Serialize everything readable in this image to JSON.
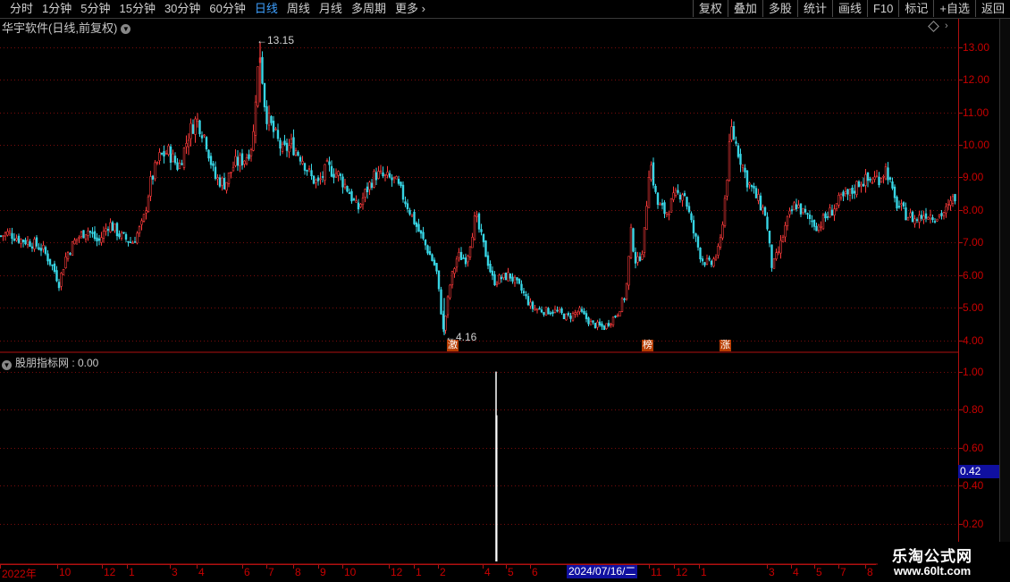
{
  "toolbar": {
    "periods": [
      "分时",
      "1分钟",
      "5分钟",
      "15分钟",
      "30分钟",
      "60分钟",
      "日线",
      "周线",
      "月线",
      "多周期",
      "更多"
    ],
    "active_period": "日线",
    "right_buttons": [
      "复权",
      "叠加",
      "多股",
      "统计",
      "画线",
      "F10",
      "标记",
      "+自选",
      "返回"
    ]
  },
  "main_chart": {
    "title": "华宇软件(日线,前复权)",
    "high_label": "13.15",
    "low_label": "4.16",
    "y_ticks": [
      "13.00",
      "12.00",
      "11.00",
      "10.00",
      "9.00",
      "8.00",
      "7.00",
      "6.00",
      "5.00",
      "4.00"
    ],
    "signals": [
      "激",
      "榜",
      "涨"
    ],
    "up_color": "#ff3b3b",
    "down_color": "#38d8e8"
  },
  "indicator": {
    "title": "股朋指标网 : 0.00",
    "y_ticks": [
      "1.00",
      "0.80",
      "0.60",
      "0.40",
      "0.20"
    ],
    "current_value": "0.42"
  },
  "time_axis": {
    "labels": [
      "2022年",
      "10",
      "12",
      "1",
      "3",
      "4",
      "6",
      "7",
      "8",
      "9",
      "10",
      "12",
      "1",
      "2",
      "4",
      "5",
      "6",
      "11",
      "12",
      "1",
      "3",
      "4",
      "5",
      "7",
      "8"
    ],
    "cursor_date": "2024/07/16/二"
  },
  "watermark": {
    "line1": "乐淘公式网",
    "line2": "www.60lt.com"
  },
  "chart_data": {
    "type": "candlestick",
    "title": "华宇软件(日线,前复权)",
    "ylim": [
      3.8,
      13.4
    ],
    "close_path": [
      [
        0,
        7.2
      ],
      [
        10,
        7.3
      ],
      [
        22,
        7.1
      ],
      [
        35,
        7.0
      ],
      [
        48,
        6.8
      ],
      [
        60,
        6.2
      ],
      [
        66,
        5.75
      ],
      [
        74,
        6.6
      ],
      [
        85,
        7.1
      ],
      [
        98,
        7.4
      ],
      [
        110,
        7.0
      ],
      [
        122,
        7.6
      ],
      [
        135,
        7.2
      ],
      [
        148,
        7.0
      ],
      [
        160,
        7.6
      ],
      [
        168,
        8.8
      ],
      [
        178,
        9.6
      ],
      [
        188,
        9.8
      ],
      [
        200,
        9.3
      ],
      [
        212,
        10.4
      ],
      [
        220,
        10.8
      ],
      [
        230,
        10.2
      ],
      [
        240,
        9.0
      ],
      [
        252,
        8.8
      ],
      [
        262,
        9.4
      ],
      [
        275,
        9.6
      ],
      [
        283,
        10.1
      ],
      [
        287,
        12.0
      ],
      [
        291,
        12.8
      ],
      [
        297,
        11.0
      ],
      [
        306,
        10.4
      ],
      [
        316,
        9.8
      ],
      [
        326,
        10.0
      ],
      [
        338,
        9.6
      ],
      [
        348,
        9.0
      ],
      [
        356,
        8.8
      ],
      [
        366,
        9.3
      ],
      [
        378,
        9.1
      ],
      [
        390,
        8.6
      ],
      [
        400,
        8.0
      ],
      [
        410,
        8.6
      ],
      [
        420,
        9.1
      ],
      [
        430,
        9.0
      ],
      [
        442,
        8.9
      ],
      [
        455,
        8.2
      ],
      [
        466,
        7.5
      ],
      [
        478,
        6.8
      ],
      [
        488,
        6.2
      ],
      [
        496,
        4.3
      ],
      [
        504,
        5.8
      ],
      [
        512,
        6.6
      ],
      [
        522,
        6.5
      ],
      [
        532,
        7.8
      ],
      [
        542,
        6.8
      ],
      [
        552,
        5.8
      ],
      [
        560,
        5.9
      ],
      [
        570,
        6.0
      ],
      [
        582,
        5.6
      ],
      [
        595,
        5.0
      ],
      [
        610,
        4.9
      ],
      [
        622,
        4.9
      ],
      [
        635,
        4.7
      ],
      [
        648,
        4.9
      ],
      [
        662,
        4.5
      ],
      [
        676,
        4.4
      ],
      [
        690,
        4.8
      ],
      [
        700,
        5.4
      ],
      [
        706,
        7.3
      ],
      [
        712,
        6.3
      ],
      [
        720,
        6.9
      ],
      [
        727,
        9.6
      ],
      [
        735,
        8.2
      ],
      [
        745,
        7.9
      ],
      [
        755,
        8.4
      ],
      [
        765,
        8.6
      ],
      [
        775,
        7.4
      ],
      [
        785,
        6.5
      ],
      [
        795,
        6.3
      ],
      [
        805,
        6.8
      ],
      [
        812,
        8.6
      ],
      [
        818,
        10.5
      ],
      [
        826,
        9.8
      ],
      [
        836,
        8.9
      ],
      [
        846,
        8.4
      ],
      [
        856,
        7.9
      ],
      [
        864,
        6.2
      ],
      [
        872,
        6.8
      ],
      [
        880,
        7.6
      ],
      [
        890,
        8.2
      ],
      [
        902,
        7.8
      ],
      [
        915,
        7.5
      ],
      [
        928,
        7.9
      ],
      [
        940,
        8.3
      ],
      [
        952,
        8.5
      ],
      [
        962,
        8.9
      ],
      [
        972,
        8.9
      ],
      [
        984,
        9.0
      ],
      [
        992,
        9.3
      ],
      [
        1000,
        8.3
      ],
      [
        1012,
        7.9
      ],
      [
        1024,
        7.7
      ],
      [
        1036,
        7.9
      ],
      [
        1048,
        7.8
      ],
      [
        1060,
        8.0
      ],
      [
        1070,
        8.5
      ]
    ],
    "indicator_series": {
      "name": "股朋指标网",
      "ylim": [
        0,
        1.05
      ],
      "spike_value": 1.0
    }
  }
}
